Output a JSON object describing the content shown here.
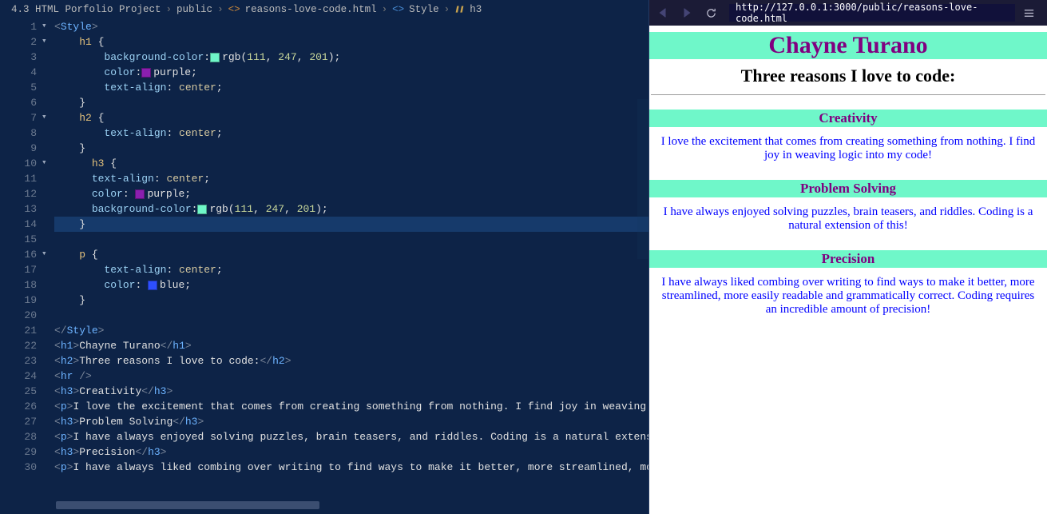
{
  "breadcrumbs": {
    "root": "4.3 HTML Porfolio Project",
    "folder": "public",
    "file": "reasons-love-code.html",
    "section": "Style",
    "symbol": "h3"
  },
  "editor": {
    "lines_start": 1,
    "active_line": 14,
    "code": [
      {
        "n": 1,
        "fold": "v",
        "seg": [
          [
            "t-punct",
            "<"
          ],
          [
            "t-tag",
            "Style"
          ],
          [
            "t-punct",
            ">"
          ]
        ]
      },
      {
        "n": 2,
        "fold": "v",
        "indent": 2,
        "seg": [
          [
            "t-sel",
            "h1"
          ],
          [
            "t-text",
            " {"
          ]
        ]
      },
      {
        "n": 3,
        "indent": 4,
        "seg": [
          [
            "t-prop",
            "background-color"
          ],
          [
            "t-text",
            ":"
          ],
          [
            "swatch",
            "sw-green"
          ],
          [
            "t-rgb",
            "rgb"
          ],
          [
            "t-text",
            "("
          ],
          [
            "t-num",
            "111"
          ],
          [
            "t-text",
            ", "
          ],
          [
            "t-num",
            "247"
          ],
          [
            "t-text",
            ", "
          ],
          [
            "t-num",
            "201"
          ],
          [
            "t-text",
            ");"
          ]
        ]
      },
      {
        "n": 4,
        "indent": 4,
        "seg": [
          [
            "t-prop",
            "color"
          ],
          [
            "t-text",
            ":"
          ],
          [
            "swatch",
            "sw-purple"
          ],
          [
            "t-kw",
            "purple"
          ],
          [
            "t-text",
            ";"
          ]
        ]
      },
      {
        "n": 5,
        "indent": 4,
        "seg": [
          [
            "t-prop",
            "text-align"
          ],
          [
            "t-text",
            ": "
          ],
          [
            "t-val",
            "center"
          ],
          [
            "t-text",
            ";"
          ]
        ]
      },
      {
        "n": 6,
        "indent": 2,
        "seg": [
          [
            "t-text",
            "}"
          ]
        ]
      },
      {
        "n": 7,
        "fold": "v",
        "indent": 2,
        "seg": [
          [
            "t-sel",
            "h2"
          ],
          [
            "t-text",
            " {"
          ]
        ]
      },
      {
        "n": 8,
        "indent": 4,
        "seg": [
          [
            "t-prop",
            "text-align"
          ],
          [
            "t-text",
            ": "
          ],
          [
            "t-val",
            "center"
          ],
          [
            "t-text",
            ";"
          ]
        ]
      },
      {
        "n": 9,
        "indent": 2,
        "seg": [
          [
            "t-text",
            "}"
          ]
        ]
      },
      {
        "n": 10,
        "fold": "v",
        "indent": 3,
        "seg": [
          [
            "t-sel",
            "h3"
          ],
          [
            "t-text",
            " {"
          ]
        ]
      },
      {
        "n": 11,
        "indent": 3,
        "seg": [
          [
            "t-prop",
            "text-align"
          ],
          [
            "t-text",
            ": "
          ],
          [
            "t-val",
            "center"
          ],
          [
            "t-text",
            ";"
          ]
        ]
      },
      {
        "n": 12,
        "indent": 3,
        "seg": [
          [
            "t-prop",
            "color"
          ],
          [
            "t-text",
            ": "
          ],
          [
            "swatch",
            "sw-purple"
          ],
          [
            "t-kw",
            "purple"
          ],
          [
            "t-text",
            ";"
          ]
        ]
      },
      {
        "n": 13,
        "indent": 3,
        "seg": [
          [
            "t-prop",
            "background-color"
          ],
          [
            "t-text",
            ":"
          ],
          [
            "swatch",
            "sw-green"
          ],
          [
            "t-rgb",
            "rgb"
          ],
          [
            "t-text",
            "("
          ],
          [
            "t-num",
            "111"
          ],
          [
            "t-text",
            ", "
          ],
          [
            "t-num",
            "247"
          ],
          [
            "t-text",
            ", "
          ],
          [
            "t-num",
            "201"
          ],
          [
            "t-text",
            ");"
          ]
        ]
      },
      {
        "n": 14,
        "indent": 2,
        "seg": [
          [
            "t-text",
            "}"
          ]
        ]
      },
      {
        "n": 15,
        "seg": []
      },
      {
        "n": 16,
        "fold": "v",
        "indent": 2,
        "seg": [
          [
            "t-sel",
            "p"
          ],
          [
            "t-text",
            " {"
          ]
        ]
      },
      {
        "n": 17,
        "indent": 4,
        "seg": [
          [
            "t-prop",
            "text-align"
          ],
          [
            "t-text",
            ": "
          ],
          [
            "t-val",
            "center"
          ],
          [
            "t-text",
            ";"
          ]
        ]
      },
      {
        "n": 18,
        "indent": 4,
        "seg": [
          [
            "t-prop",
            "color"
          ],
          [
            "t-text",
            ": "
          ],
          [
            "swatch",
            "sw-blue"
          ],
          [
            "t-kw",
            "blue"
          ],
          [
            "t-text",
            ";"
          ]
        ]
      },
      {
        "n": 19,
        "indent": 2,
        "seg": [
          [
            "t-text",
            "}"
          ]
        ]
      },
      {
        "n": 20,
        "seg": []
      },
      {
        "n": 21,
        "seg": [
          [
            "t-punct",
            "</"
          ],
          [
            "t-tag",
            "Style"
          ],
          [
            "t-punct",
            ">"
          ]
        ]
      },
      {
        "n": 22,
        "seg": [
          [
            "t-punct",
            "<"
          ],
          [
            "t-tag",
            "h1"
          ],
          [
            "t-punct",
            ">"
          ],
          [
            "t-text",
            "Chayne Turano"
          ],
          [
            "t-punct",
            "</"
          ],
          [
            "t-tag",
            "h1"
          ],
          [
            "t-punct",
            ">"
          ]
        ]
      },
      {
        "n": 23,
        "seg": [
          [
            "t-punct",
            "<"
          ],
          [
            "t-tag",
            "h2"
          ],
          [
            "t-punct",
            ">"
          ],
          [
            "t-text",
            "Three reasons I love to code:"
          ],
          [
            "t-punct",
            "</"
          ],
          [
            "t-tag",
            "h2"
          ],
          [
            "t-punct",
            ">"
          ]
        ]
      },
      {
        "n": 24,
        "seg": [
          [
            "t-punct",
            "<"
          ],
          [
            "t-tag",
            "hr"
          ],
          [
            "t-text",
            " "
          ],
          [
            "t-punct",
            "/>"
          ]
        ]
      },
      {
        "n": 25,
        "seg": [
          [
            "t-punct",
            "<"
          ],
          [
            "t-tag",
            "h3"
          ],
          [
            "t-punct",
            ">"
          ],
          [
            "t-text",
            "Creativity"
          ],
          [
            "t-punct",
            "</"
          ],
          [
            "t-tag",
            "h3"
          ],
          [
            "t-punct",
            ">"
          ]
        ]
      },
      {
        "n": 26,
        "seg": [
          [
            "t-punct",
            "<"
          ],
          [
            "t-tag",
            "p"
          ],
          [
            "t-punct",
            ">"
          ],
          [
            "t-text",
            "I love the excitement that comes from creating something from nothing. I find joy in weaving lo"
          ]
        ]
      },
      {
        "n": 27,
        "seg": [
          [
            "t-punct",
            "<"
          ],
          [
            "t-tag",
            "h3"
          ],
          [
            "t-punct",
            ">"
          ],
          [
            "t-text",
            "Problem Solving"
          ],
          [
            "t-punct",
            "</"
          ],
          [
            "t-tag",
            "h3"
          ],
          [
            "t-punct",
            ">"
          ]
        ]
      },
      {
        "n": 28,
        "seg": [
          [
            "t-punct",
            "<"
          ],
          [
            "t-tag",
            "p"
          ],
          [
            "t-punct",
            ">"
          ],
          [
            "t-text",
            "I have always enjoyed solving puzzles, brain teasers, and riddles. Coding is a natural extensio"
          ]
        ]
      },
      {
        "n": 29,
        "seg": [
          [
            "t-punct",
            "<"
          ],
          [
            "t-tag",
            "h3"
          ],
          [
            "t-punct",
            ">"
          ],
          [
            "t-text",
            "Precision"
          ],
          [
            "t-punct",
            "</"
          ],
          [
            "t-tag",
            "h3"
          ],
          [
            "t-punct",
            ">"
          ]
        ]
      },
      {
        "n": 30,
        "seg": [
          [
            "t-punct",
            "<"
          ],
          [
            "t-tag",
            "p"
          ],
          [
            "t-punct",
            ">"
          ],
          [
            "t-text",
            "I have always liked combing over writing to find ways to make it better, more streamlined, mor"
          ]
        ]
      }
    ]
  },
  "preview": {
    "url": "http://127.0.0.1:3000/public/reasons-love-code.html",
    "page": {
      "h1": "Chayne Turano",
      "h2": "Three reasons I love to code:",
      "sections": [
        {
          "h3": "Creativity",
          "p": "I love the excitement that comes from creating something from nothing. I find joy in weaving logic into my code!"
        },
        {
          "h3": "Problem Solving",
          "p": "I have always enjoyed solving puzzles, brain teasers, and riddles. Coding is a natural extension of this!"
        },
        {
          "h3": "Precision",
          "p": "I have always liked combing over writing to find ways to make it better, more streamlined, more easily readable and grammatically correct. Coding requires an incredible amount of precision!"
        }
      ]
    }
  }
}
